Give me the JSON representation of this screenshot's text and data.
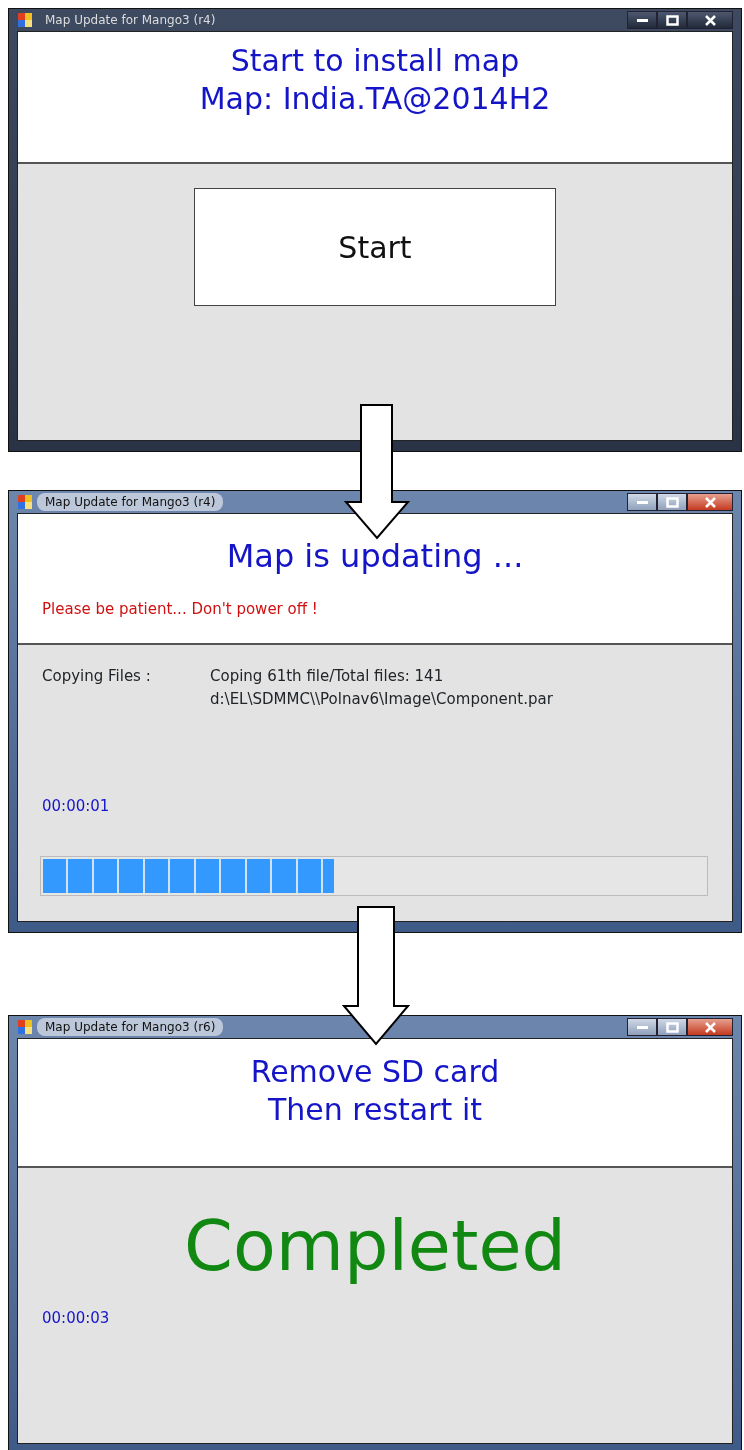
{
  "windows": [
    {
      "title": "Map Update for Mango3 (r4)",
      "active": false,
      "kind": "start",
      "header_lines": [
        "Start to install map",
        "Map: India.TA@2014H2"
      ],
      "button": "Start"
    },
    {
      "title": "Map Update for Mango3 (r4)",
      "active": true,
      "kind": "progress",
      "heading": "Map is updating ...",
      "warning": "Please be patient... Don't power off !",
      "status_label": "Copying Files :",
      "status_lines": [
        "Coping 61th file/Total files: 141",
        "d:\\EL\\SDMMC\\\\Polnav6\\Image\\Component.par"
      ],
      "elapsed": "00:00:01",
      "progress": {
        "level": 0.44
      }
    },
    {
      "title": "Map Update for Mango3 (r6)",
      "active": true,
      "kind": "done",
      "header_lines": [
        "Remove SD card",
        "Then restart it"
      ],
      "result": "Completed",
      "elapsed": "00:00:03"
    }
  ]
}
